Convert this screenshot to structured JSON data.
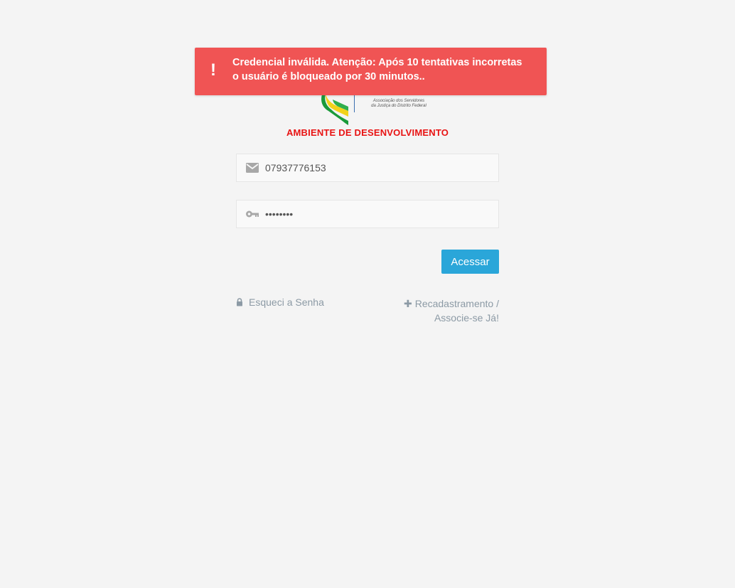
{
  "logo": {
    "subtitle_line1": "Associação dos Servidores",
    "subtitle_line2": "da Justiça do Distrito Federal",
    "icon": "assejus-logo"
  },
  "environment_label": "AMBIENTE DE DESENVOLVIMENTO",
  "login_form": {
    "username": {
      "value": "07937776153",
      "icon": "envelope-icon"
    },
    "password": {
      "value": "••••••••",
      "icon": "key-icon"
    },
    "submit_label": "Acessar"
  },
  "links": {
    "forgot_password": "Esqueci a Senha",
    "register_line1": "Recadastramento /",
    "register_line2": "Associe-se Já!"
  },
  "toast": {
    "icon_glyph": "!",
    "message_line1": "Credencial inválida. Atenção: Após 10 tentativas incorretas",
    "message_line2": "o usuário é bloqueado por 30 minutos..",
    "color": "#f05454"
  },
  "colors": {
    "accent": "#2aa6d9",
    "env_label": "#e81313",
    "background": "#f4f4f4"
  }
}
